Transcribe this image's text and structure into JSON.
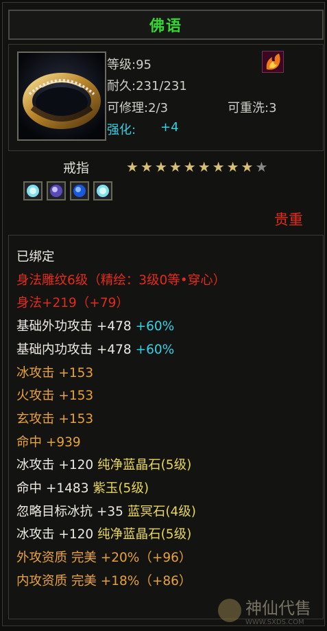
{
  "title": "佛语",
  "item": {
    "level": "等级:95",
    "durability": "耐久:231/231",
    "repairable": "可修理:2/3",
    "rewashable": "可重洗:3",
    "enhance_label": "强化:",
    "enhance_value": "+4",
    "type": "戒指",
    "stars_filled": 9,
    "stars_total": 10,
    "gem_icons": [
      "gem-cyan-icon",
      "gem-purple-icon",
      "gem-blue-icon",
      "gem-cyan-icon"
    ],
    "rarity": "贵重"
  },
  "attributes": [
    {
      "parts": [
        {
          "text": "已绑定",
          "color": "white"
        }
      ]
    },
    {
      "parts": [
        {
          "text": "身法雕纹6级（精绘：3级0等•穿心）",
          "color": "red"
        }
      ]
    },
    {
      "parts": [
        {
          "text": "身法+219（+79）",
          "color": "red"
        }
      ]
    },
    {
      "parts": [
        {
          "text": "基础外功攻击 +478 ",
          "color": "white"
        },
        {
          "text": "+60%",
          "color": "cyan"
        }
      ]
    },
    {
      "parts": [
        {
          "text": "基础内功攻击 +478 ",
          "color": "white"
        },
        {
          "text": "+60%",
          "color": "cyan"
        }
      ]
    },
    {
      "parts": [
        {
          "text": "冰攻击 +153",
          "color": "orange"
        }
      ]
    },
    {
      "parts": [
        {
          "text": "火攻击 +153",
          "color": "orange"
        }
      ]
    },
    {
      "parts": [
        {
          "text": "玄攻击 +153",
          "color": "orange"
        }
      ]
    },
    {
      "parts": [
        {
          "text": "命中 +939",
          "color": "orange"
        }
      ]
    },
    {
      "parts": [
        {
          "text": "冰攻击 +120 ",
          "color": "white"
        },
        {
          "text": "纯净蓝晶石(5级)",
          "color": "yellow"
        }
      ]
    },
    {
      "parts": [
        {
          "text": "命中 +1483 ",
          "color": "white"
        },
        {
          "text": "紫玉(5级)",
          "color": "yellow"
        }
      ]
    },
    {
      "parts": [
        {
          "text": "忽略目标冰抗 +35 ",
          "color": "white"
        },
        {
          "text": "蓝冥石(4级)",
          "color": "yellow"
        }
      ]
    },
    {
      "parts": [
        {
          "text": "冰攻击 +120 ",
          "color": "white"
        },
        {
          "text": "纯净蓝晶石(5级)",
          "color": "yellow"
        }
      ]
    },
    {
      "parts": [
        {
          "text": "外攻资质  完美 +20%（+96）",
          "color": "orange"
        }
      ]
    },
    {
      "parts": [
        {
          "text": "内攻资质  完美 +18%（+86）",
          "color": "orange"
        }
      ]
    }
  ],
  "watermark": {
    "text": "神仙代售",
    "sub": "WWW.SXDS.COM"
  }
}
